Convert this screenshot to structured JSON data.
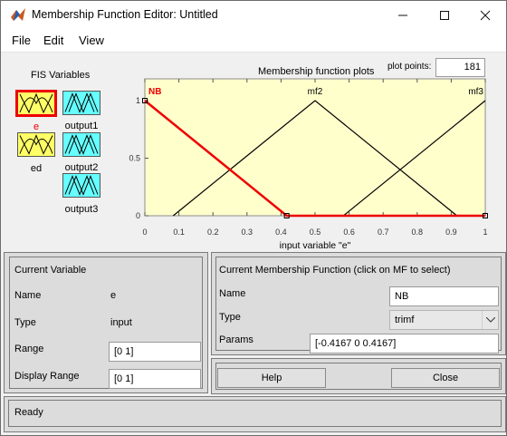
{
  "window": {
    "title": "Membership Function Editor: Untitled"
  },
  "menu": [
    "File",
    "Edit",
    "View"
  ],
  "fis": {
    "heading": "FIS Variables",
    "inputs": [
      {
        "name": "e",
        "selected": true,
        "color": "#ee0000"
      },
      {
        "name": "ed"
      }
    ],
    "outputs": [
      {
        "name": "output1"
      },
      {
        "name": "output2"
      },
      {
        "name": "output3"
      }
    ]
  },
  "plot": {
    "title": "Membership function plots",
    "points_label": "plot points:",
    "points_value": "181",
    "xlabel": "input variable \"e\"",
    "mf_labels": [
      "NB",
      "mf2",
      "mf3"
    ]
  },
  "chart_data": {
    "type": "line",
    "xlim": [
      0,
      1
    ],
    "ylim": [
      0,
      1
    ],
    "x_ticks": [
      "0",
      "0.1",
      "0.2",
      "0.3",
      "0.4",
      "0.5",
      "0.6",
      "0.7",
      "0.8",
      "0.9",
      "1"
    ],
    "y_ticks": [
      "0",
      "0.5",
      "1"
    ],
    "background": "#ffffcc",
    "series": [
      {
        "name": "NB",
        "color": "#ee0000",
        "selected": true,
        "points": [
          [
            0,
            1
          ],
          [
            0.4167,
            0
          ],
          [
            1,
            0
          ]
        ]
      },
      {
        "name": "mf2",
        "color": "#000000",
        "points": [
          [
            0.0833,
            0
          ],
          [
            0.5,
            1
          ],
          [
            0.9167,
            0
          ]
        ]
      },
      {
        "name": "mf3",
        "color": "#000000",
        "points": [
          [
            0.5833,
            0
          ],
          [
            1,
            1
          ]
        ]
      }
    ]
  },
  "current_variable": {
    "heading": "Current Variable",
    "name_label": "Name",
    "name_value": "e",
    "type_label": "Type",
    "type_value": "input",
    "range_label": "Range",
    "range_value": "[0 1]",
    "display_range_label": "Display Range",
    "display_range_value": "[0 1]"
  },
  "current_mf": {
    "heading": "Current Membership Function (click on MF to select)",
    "name_label": "Name",
    "name_value": "NB",
    "type_label": "Type",
    "type_value": "trimf",
    "params_label": "Params",
    "params_value": "[-0.4167 0 0.4167]"
  },
  "buttons": {
    "help": "Help",
    "close": "Close"
  },
  "status": "Ready"
}
